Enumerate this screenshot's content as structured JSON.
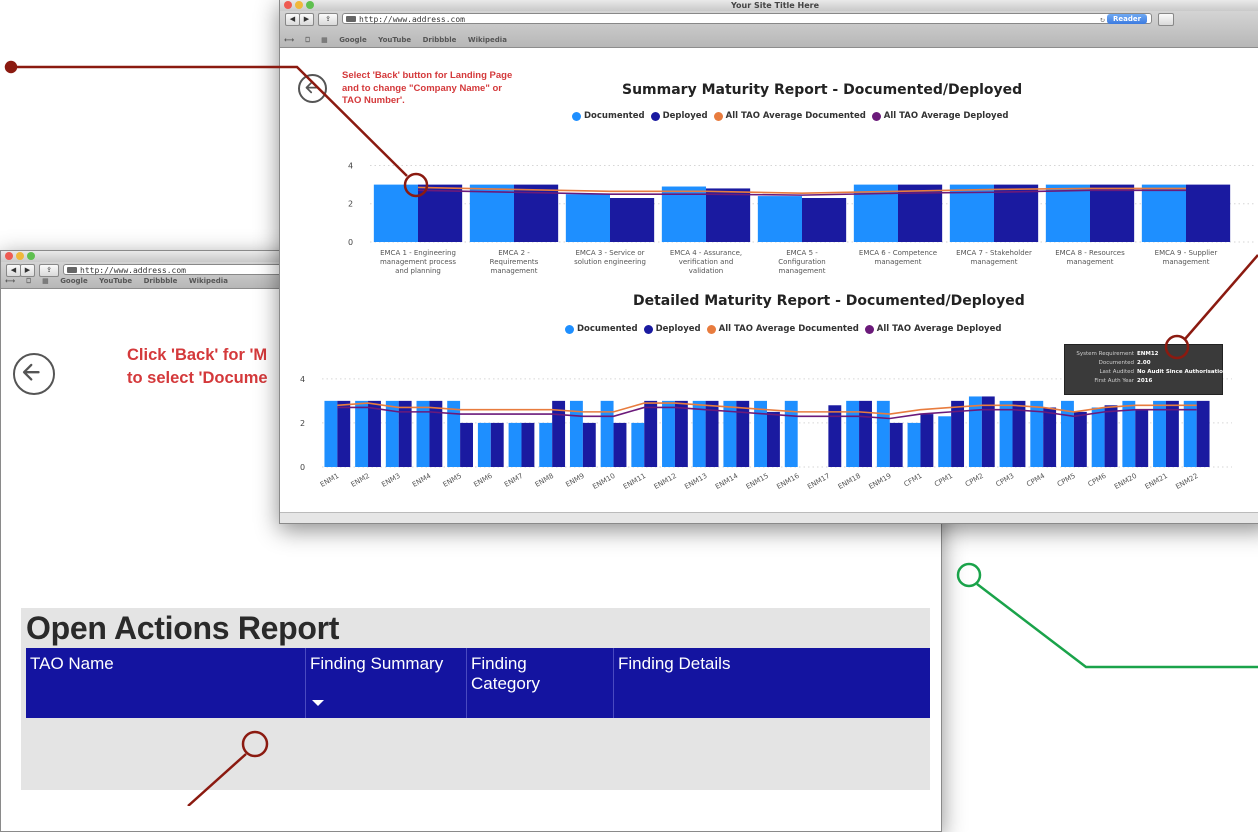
{
  "colors": {
    "documented": "#1e8fff",
    "deployed": "#1a1aa0",
    "avg_documented": "#e87c3e",
    "avg_deployed": "#6b1a7a",
    "annotation_red": "#8b1a10",
    "annotation_green": "#1aa34a",
    "note_text": "#d4393b",
    "table_header": "#1414a0"
  },
  "back_window": {
    "url": "http://www.address.com",
    "bookmarks": [
      "Google",
      "YouTube",
      "Dribbble",
      "Wikipedia"
    ],
    "note": [
      "Click 'Back' for 'M",
      "to select 'Docume"
    ],
    "back_icon": "back-arrow-icon",
    "open_actions": {
      "title": "Open Actions Report",
      "columns": [
        "TAO Name",
        "Finding Summary",
        "Finding Category",
        "Finding Details"
      ]
    }
  },
  "front_window": {
    "title": "Your Site Title Here",
    "url": "http://www.address.com",
    "reader_label": "Reader",
    "bookmarks": [
      "Google",
      "YouTube",
      "Dribbble",
      "Wikipedia"
    ],
    "note": [
      "Select 'Back' button for Landing Page",
      "and to change \"Company Name\" or",
      "TAO Number'."
    ],
    "back_icon": "back-arrow-icon",
    "legend": [
      "Documented",
      "Deployed",
      "All TAO Average Documented",
      "All TAO Average Deployed"
    ],
    "tooltip": [
      {
        "k": "System Requirement",
        "v": "ENM12"
      },
      {
        "k": "Documented",
        "v": "2.00"
      },
      {
        "k": "Last Audited",
        "v": "No Audit Since Authorisation"
      },
      {
        "k": "First Auth Year",
        "v": "2016"
      }
    ]
  },
  "chart_data": [
    {
      "type": "bar",
      "title": "Summary Maturity Report - Documented/Deployed",
      "yticks": [
        0,
        2,
        4
      ],
      "ylim": [
        0,
        4.6
      ],
      "categories": [
        [
          "EMCA 1 - Engineering",
          "management process",
          "and planning"
        ],
        [
          "EMCA 2 -",
          "Requirements",
          "management"
        ],
        [
          "EMCA 3 - Service or",
          "solution engineering"
        ],
        [
          "EMCA 4 - Assurance,",
          "verification and",
          "validation"
        ],
        [
          "EMCA 5 -",
          "Configuration",
          "management"
        ],
        [
          "EMCA 6 - Competence",
          "management"
        ],
        [
          "EMCA 7 - Stakeholder",
          "management"
        ],
        [
          "EMCA 8 - Resources",
          "management"
        ],
        [
          "EMCA 9 - Supplier",
          "management"
        ]
      ],
      "series": [
        {
          "name": "Documented",
          "values": [
            3.0,
            3.0,
            2.5,
            2.9,
            2.4,
            3.0,
            3.0,
            3.0,
            3.0
          ]
        },
        {
          "name": "Deployed",
          "values": [
            3.0,
            3.0,
            2.3,
            2.8,
            2.3,
            3.0,
            3.0,
            3.0,
            3.0
          ]
        },
        {
          "name": "All TAO Average Documented",
          "values": [
            2.85,
            2.75,
            2.65,
            2.65,
            2.55,
            2.65,
            2.75,
            2.8,
            2.8
          ]
        },
        {
          "name": "All TAO Average Deployed",
          "values": [
            2.7,
            2.6,
            2.5,
            2.5,
            2.45,
            2.55,
            2.6,
            2.7,
            2.7
          ]
        }
      ]
    },
    {
      "type": "bar",
      "title": "Detailed Maturity Report - Documented/Deployed",
      "yticks": [
        0,
        2,
        4
      ],
      "ylim": [
        0,
        4.4
      ],
      "categories": [
        "ENM1",
        "ENM2",
        "ENM3",
        "ENM4",
        "ENM5",
        "ENM6",
        "ENM7",
        "ENM8",
        "ENM9",
        "ENM10",
        "ENM11",
        "ENM12",
        "ENM13",
        "ENM14",
        "ENM15",
        "ENM16",
        "ENM17",
        "ENM18",
        "ENM19",
        "CFM1",
        "CPM1",
        "CPM2",
        "CPM3",
        "CPM4",
        "CPM5",
        "CPM6",
        "ENM20",
        "ENM21",
        "ENM22"
      ],
      "series": [
        {
          "name": "Documented",
          "values": [
            3,
            3,
            3,
            3,
            3,
            2,
            2,
            2,
            3,
            3,
            2,
            3,
            3,
            3,
            3,
            3,
            0,
            3,
            3,
            2,
            2.3,
            3.2,
            3,
            3,
            3,
            2.7,
            3,
            3,
            3
          ]
        },
        {
          "name": "Deployed",
          "values": [
            3,
            3,
            3,
            3,
            2,
            2,
            2,
            3,
            2,
            2,
            3,
            3,
            3,
            3,
            2.5,
            0,
            2.8,
            3,
            2,
            2.4,
            3,
            3.2,
            3,
            2.7,
            2.5,
            2.8,
            2.6,
            3,
            3
          ]
        },
        {
          "name": "All TAO Average Documented",
          "values": [
            2.8,
            2.9,
            2.7,
            2.7,
            2.6,
            2.6,
            2.6,
            2.6,
            2.5,
            2.5,
            2.9,
            2.9,
            2.8,
            2.7,
            2.6,
            2.5,
            2.5,
            2.5,
            2.4,
            2.6,
            2.7,
            2.8,
            2.8,
            2.7,
            2.5,
            2.7,
            2.8,
            2.8,
            2.8
          ]
        },
        {
          "name": "All TAO Average Deployed",
          "values": [
            2.7,
            2.7,
            2.5,
            2.5,
            2.4,
            2.4,
            2.4,
            2.4,
            2.3,
            2.3,
            2.7,
            2.7,
            2.6,
            2.5,
            2.4,
            2.3,
            2.3,
            2.3,
            2.2,
            2.4,
            2.5,
            2.6,
            2.6,
            2.5,
            2.3,
            2.5,
            2.6,
            2.6,
            2.6
          ]
        }
      ]
    }
  ]
}
